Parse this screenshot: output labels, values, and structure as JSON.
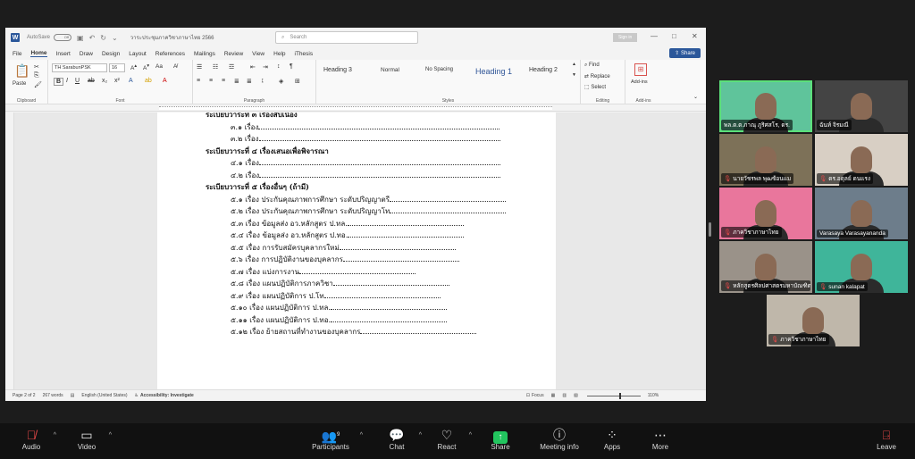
{
  "word": {
    "autosave": "AutoSave",
    "autosave_state": "Off",
    "doc_title": "วาระประชุมภาควิชาภาษาไทย 2566",
    "search_placeholder": "Search",
    "sign_in": "Sign in",
    "menu": [
      "File",
      "Home",
      "Insert",
      "Draw",
      "Design",
      "Layout",
      "References",
      "Mailings",
      "Review",
      "View",
      "Help",
      "iThesis"
    ],
    "share": "Share",
    "ribbon": {
      "paste": "Paste",
      "font_name": "TH SarabunPSK",
      "font_size": "16",
      "styles": [
        "Heading 3",
        "Normal",
        "No Spacing",
        "Heading 1",
        "Heading 2"
      ],
      "find": "Find",
      "replace": "Replace",
      "select": "Select",
      "addins": "Add-ins",
      "groups": [
        "Clipboard",
        "Font",
        "Paragraph",
        "Styles",
        "Editing",
        "Add-ins"
      ]
    },
    "lines": [
      {
        "text": "ระเบียบวาระที่ ๓ เรื่องสืบเนื่อง",
        "head": true,
        "cut": true
      },
      {
        "text": "๓.๑ เรื่อง",
        "head": false,
        "dots": true
      },
      {
        "text": "๓.๒ เรื่อง",
        "head": false,
        "dots": true
      },
      {
        "text": "ระเบียบวาระที่ ๔ เรื่องเสนอเพื่อพิจารณา",
        "head": true
      },
      {
        "text": "๔.๑ เรื่อง",
        "head": false,
        "dots": true
      },
      {
        "text": "๔.๒ เรื่อง",
        "head": false,
        "dots": true
      },
      {
        "text": "ระเบียบวาระที่ ๕ เรื่องอื่นๆ (ถ้ามี)",
        "head": true
      },
      {
        "text": "๕.๑ เรื่อง   ประกันคุณภาพการศึกษา ระดับปริญญาตรี",
        "head": false,
        "dots": true
      },
      {
        "text": "๕.๒ เรื่อง   ประกันคุณภาพการศึกษา ระดับปริญญาโท",
        "head": false,
        "dots": true
      },
      {
        "text": "๕.๓ เรื่อง   ข้อมูลส่ง อว.หลักสูตร ป.ทล.",
        "head": false,
        "dots": true
      },
      {
        "text": "๕.๔ เรื่อง   ข้อมูลส่ง อว.หลักสูตร ป.ทอ.",
        "head": false,
        "dots": true
      },
      {
        "text": "๕.๕ เรื่อง   การรับสมัครบุคลากรใหม่",
        "head": false,
        "dots": true
      },
      {
        "text": "๕.๖ เรื่อง   การปฏิบัติงานของบุคลากร",
        "head": false,
        "dots": true
      },
      {
        "text": "๕.๗ เรื่อง   แบ่งการงาน",
        "head": false,
        "dots": true
      },
      {
        "text": "๕.๘ เรื่อง   แผนปฏิบัติการภาควิชา",
        "head": false,
        "dots": true
      },
      {
        "text": "๕.๙ เรื่อง   แผนปฏิบัติการ ป.โท",
        "head": false,
        "dots": true
      },
      {
        "text": "๕.๑๐ เรื่อง   แผนปฏิบัติการ ป.ทล.",
        "head": false,
        "dots": true
      },
      {
        "text": "๕.๑๑ เรื่อง   แผนปฏิบัติการ ป.ทอ.",
        "head": false,
        "dots": true
      },
      {
        "text": "๕.๑๒ เรื่อง   ย้ายสถานที่ทำงานของบุคลากร",
        "head": false,
        "dots": true
      }
    ],
    "status": {
      "page": "Page 2 of 2",
      "words": "267 words",
      "lang": "English (United States)",
      "accessibility": "Accessibility: Investigate",
      "focus": "Focus",
      "zoom": "110%"
    }
  },
  "participants": [
    {
      "name": "พล.ต.ต.ภาณุ ภูริศสโร, ดร.",
      "active": true,
      "muted": false,
      "bg": "#5fc49b"
    },
    {
      "name": "ฉันท์ จิรมณี",
      "active": false,
      "muted": false,
      "bg": "#444444"
    },
    {
      "name": "นายวัชรพล พุฒซ้อนแม",
      "active": false,
      "muted": true,
      "bg": "#7d7158"
    },
    {
      "name": "ดร.อดุลย์ ดนแรง",
      "active": false,
      "muted": true,
      "bg": "#d8cfc4"
    },
    {
      "name": "ภาควิชาภาษาไทย",
      "active": false,
      "muted": true,
      "bg": "#e9769c"
    },
    {
      "name": "Varasaya Varasayananda",
      "active": false,
      "muted": false,
      "bg": "#6d7d8b"
    },
    {
      "name": "หลักสูตรศิลปศาสตรมหาบัณฑิต",
      "active": false,
      "muted": true,
      "bg": "#9a9289"
    },
    {
      "name": "sunan kalapat",
      "active": false,
      "muted": true,
      "bg": "#3fb59a"
    },
    {
      "name": "ภาควิชาภาษาไทย",
      "active": false,
      "muted": true,
      "bg": "#bfb7aa"
    }
  ],
  "toolbar": {
    "audio": "Audio",
    "video": "Video",
    "participants": "Participants",
    "participants_count": "9",
    "chat": "Chat",
    "react": "React",
    "share": "Share",
    "meeting_info": "Meeting info",
    "apps": "Apps",
    "more": "More",
    "leave": "Leave"
  }
}
